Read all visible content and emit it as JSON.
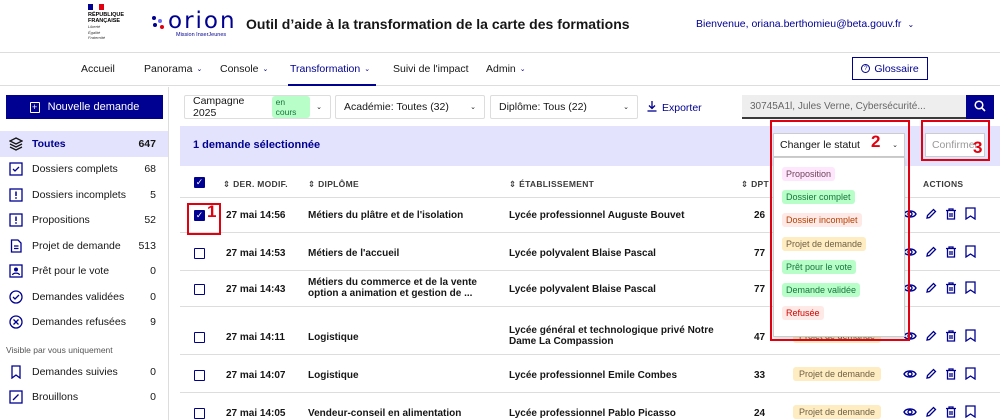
{
  "brand": {
    "marianne_lines": [
      "République",
      "Française"
    ],
    "motto_lines": [
      "Liberté",
      "Égalité",
      "Fraternité"
    ],
    "logo_text": "orion",
    "logo_sub": "Mission InserJeunes",
    "app_title": "Outil d’aide à la transformation de la carte des formations",
    "welcome": "Bienvenue, oriana.berthomieu@beta.gouv.fr",
    "colors": {
      "primary": "#000091",
      "red": "#e1000f"
    }
  },
  "nav": {
    "items": [
      "Accueil",
      "Panorama",
      "Console",
      "Transformation",
      "Suivi de l'impact",
      "Admin"
    ],
    "active": "Transformation",
    "glossary": "Glossaire"
  },
  "sidebar": {
    "new_request": "Nouvelle demande",
    "items": [
      {
        "label": "Toutes",
        "count": "647",
        "icon": "stack-icon"
      },
      {
        "label": "Dossiers complets",
        "count": "68",
        "icon": "checkbox-icon"
      },
      {
        "label": "Dossiers incomplets",
        "count": "5",
        "icon": "alert-square-icon"
      },
      {
        "label": "Propositions",
        "count": "52",
        "icon": "alert-square-icon"
      },
      {
        "label": "Projet de demande",
        "count": "513",
        "icon": "document-icon"
      },
      {
        "label": "Prêt pour le vote",
        "count": "0",
        "icon": "user-badge-icon"
      },
      {
        "label": "Demandes validées",
        "count": "0",
        "icon": "check-circle-icon"
      },
      {
        "label": "Demandes refusées",
        "count": "9",
        "icon": "close-circle-icon"
      }
    ],
    "private_caption": "Visible par vous uniquement",
    "private_items": [
      {
        "label": "Demandes suivies",
        "count": "0",
        "icon": "bookmark-icon"
      },
      {
        "label": "Brouillons",
        "count": "0",
        "icon": "draft-icon"
      }
    ]
  },
  "filters": {
    "campaign": "Campagne 2025",
    "campaign_badge": "en cours",
    "academy": "Académie: Toutes (32)",
    "diploma": "Diplôme: Tous (22)",
    "export": "Exporter",
    "search_placeholder": "30745A1l, Jules Verne, Cybersécurité..."
  },
  "table": {
    "selection_text": "1 demande sélectionnée",
    "headers": [
      "DER. MODIF.",
      "DIPLÔME",
      "ÉTABLISSEMENT",
      "DPT",
      "ACTIONS"
    ],
    "rows": [
      {
        "date": "27 mai 14:56",
        "diploma": "Métiers du plâtre et de l'isolation",
        "etab": "Lycée professionnel Auguste Bouvet",
        "dpt": "26",
        "status": "",
        "checked": true
      },
      {
        "date": "27 mai 14:53",
        "diploma": "Métiers de l'accueil",
        "etab": "Lycée polyvalent Blaise Pascal",
        "dpt": "77",
        "status": "",
        "checked": false
      },
      {
        "date": "27 mai 14:43",
        "diploma": "Métiers du commerce et de la vente option a animation et gestion de ...",
        "etab": "Lycée polyvalent Blaise Pascal",
        "dpt": "77",
        "status": "",
        "checked": false
      },
      {
        "date": "27 mai 14:11",
        "diploma": "Logistique",
        "etab": "Lycée général et technologique privé Notre Dame La Compassion",
        "dpt": "47",
        "status": "Projet de demande",
        "checked": false
      },
      {
        "date": "27 mai 14:07",
        "diploma": "Logistique",
        "etab": "Lycée professionnel Emile Combes",
        "dpt": "33",
        "status": "Projet de demande",
        "checked": false
      },
      {
        "date": "27 mai 14:05",
        "diploma": "Vendeur-conseil en alimentation",
        "etab": "Lycée professionnel Pablo Picasso",
        "dpt": "24",
        "status": "Projet de demande",
        "checked": false
      }
    ]
  },
  "status_menu": {
    "placeholder": "Changer le statut",
    "confirm": "Confirmer",
    "options": [
      {
        "label": "Proposition",
        "bg": "#fee7fc",
        "fg": "#6e445a"
      },
      {
        "label": "Dossier complet",
        "bg": "#b8fec9",
        "fg": "#18753c"
      },
      {
        "label": "Dossier incomplet",
        "bg": "#ffe9e6",
        "fg": "#b34000"
      },
      {
        "label": "Projet de demande",
        "bg": "#feecc2",
        "fg": "#716043"
      },
      {
        "label": "Prêt pour le vote",
        "bg": "#b8fec9",
        "fg": "#18753c"
      },
      {
        "label": "Demande validée",
        "bg": "#b8fec9",
        "fg": "#18753c"
      },
      {
        "label": "Refusée",
        "bg": "#ffe9e6",
        "fg": "#ce0500"
      }
    ]
  },
  "annotations": {
    "n1": "1",
    "n2": "2",
    "n3": "3"
  }
}
